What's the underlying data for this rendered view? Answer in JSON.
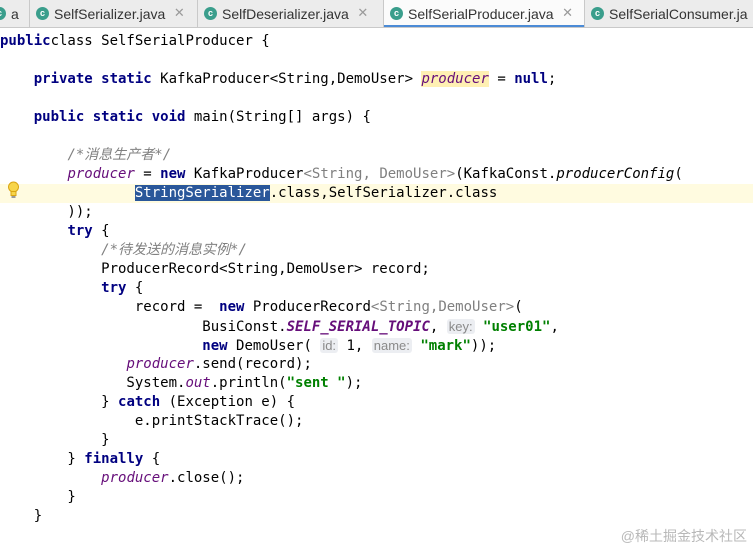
{
  "tabs": [
    {
      "label": "a",
      "icon": "java-class-icon",
      "closable": false,
      "active": false
    },
    {
      "label": "SelfSerializer.java",
      "icon": "java-class-icon",
      "closable": true,
      "active": false
    },
    {
      "label": "SelfDeserializer.java",
      "icon": "java-class-icon",
      "closable": true,
      "active": false
    },
    {
      "label": "SelfSerialProducer.java",
      "icon": "java-class-icon",
      "closable": true,
      "active": true
    },
    {
      "label": "SelfSerialConsumer.ja",
      "icon": "java-class-icon",
      "closable": false,
      "active": false
    }
  ],
  "code": [
    [
      [
        "kw",
        "public"
      ],
      [
        "",
        "class SelfSerialProducer {"
      ],
      [
        "kw",
        ""
      ],
      [
        "",
        ""
      ]
    ],
    [],
    [
      [
        "",
        "    "
      ],
      [
        "kw",
        "private static "
      ],
      [
        "",
        "KafkaProducer<String,DemoUser> "
      ],
      [
        "fld hl-field",
        "producer"
      ],
      [
        "",
        ""
      ],
      [
        "",
        " = "
      ],
      [
        "kw",
        "null"
      ],
      [
        "",
        ";"
      ]
    ],
    [],
    [
      [
        "",
        "    "
      ],
      [
        "kw",
        "public static void "
      ],
      [
        "",
        "main(String[] args) {"
      ]
    ],
    [],
    [
      [
        "",
        "        "
      ],
      [
        "cm",
        "/*消息生产者*/"
      ]
    ],
    [
      [
        "",
        "        "
      ],
      [
        "fld",
        "producer"
      ],
      [
        "",
        " = "
      ],
      [
        "kw",
        "new "
      ],
      [
        "",
        "KafkaProducer"
      ],
      [
        "gen",
        "<String, DemoUser>"
      ],
      [
        "",
        "(KafkaConst."
      ],
      [
        "ital",
        "producerConfig"
      ],
      [
        "",
        "("
      ]
    ],
    [
      [
        "",
        "                "
      ],
      [
        "sel",
        "StringSerializer"
      ],
      [
        "",
        ".class"
      ],
      [
        "",
        ",SelfSerializer"
      ],
      [
        "",
        ".class"
      ]
    ],
    [
      [
        "",
        "        ));"
      ]
    ],
    [
      [
        "",
        "        "
      ],
      [
        "kw",
        "try "
      ],
      [
        "",
        "{"
      ]
    ],
    [
      [
        "",
        "            "
      ],
      [
        "cm",
        "/*待发送的消息实例*/"
      ]
    ],
    [
      [
        "",
        "            ProducerRecord<String,DemoUser> record;"
      ]
    ],
    [
      [
        "",
        "            "
      ],
      [
        "kw",
        "try "
      ],
      [
        "",
        "{"
      ]
    ],
    [
      [
        "",
        "                record =  "
      ],
      [
        "kw",
        "new "
      ],
      [
        "",
        "ProducerRecord"
      ],
      [
        "gen",
        "<String,DemoUser>"
      ],
      [
        "",
        "("
      ]
    ],
    [
      [
        "",
        "                        BusiConst."
      ],
      [
        "cst",
        "SELF_SERIAL_TOPIC"
      ],
      [
        "",
        ", "
      ],
      [
        "hint",
        "key:"
      ],
      [
        "",
        " "
      ],
      [
        "str",
        "\"user01\""
      ],
      [
        "",
        ","
      ]
    ],
    [
      [
        "",
        "                        "
      ],
      [
        "kw",
        "new "
      ],
      [
        "",
        "DemoUser( "
      ],
      [
        "hint",
        "id:"
      ],
      [
        "",
        " 1, "
      ],
      [
        "hint",
        "name:"
      ],
      [
        "",
        " "
      ],
      [
        "str",
        "\"mark\""
      ],
      [
        "",
        "));"
      ]
    ],
    [
      [
        "",
        "               "
      ],
      [
        "fld",
        "producer"
      ],
      [
        "",
        ".send(record);"
      ]
    ],
    [
      [
        "",
        "               System."
      ],
      [
        "fld",
        "out"
      ],
      [
        "",
        ".println("
      ],
      [
        "str",
        "\"sent \""
      ],
      [
        "",
        ");"
      ]
    ],
    [
      [
        "",
        "            } "
      ],
      [
        "kw",
        "catch "
      ],
      [
        "",
        "(Exception e) {"
      ]
    ],
    [
      [
        "",
        "                e.printStackTrace();"
      ]
    ],
    [
      [
        "",
        "            }"
      ]
    ],
    [
      [
        "",
        "        } "
      ],
      [
        "kw",
        "finally "
      ],
      [
        "",
        "{"
      ]
    ],
    [
      [
        "",
        "            "
      ],
      [
        "fld",
        "producer"
      ],
      [
        "",
        ".close();"
      ]
    ],
    [
      [
        "",
        "        }"
      ]
    ],
    [
      [
        "",
        "    }"
      ]
    ]
  ],
  "caret_line": 8,
  "watermark": "@稀土掘金技术社区",
  "colors": {
    "keyword": "#000080",
    "comment": "#808080",
    "field": "#660e7a",
    "string": "#008000",
    "selection": "#2a579a",
    "active_tab_underline": "#4b8bd6"
  }
}
